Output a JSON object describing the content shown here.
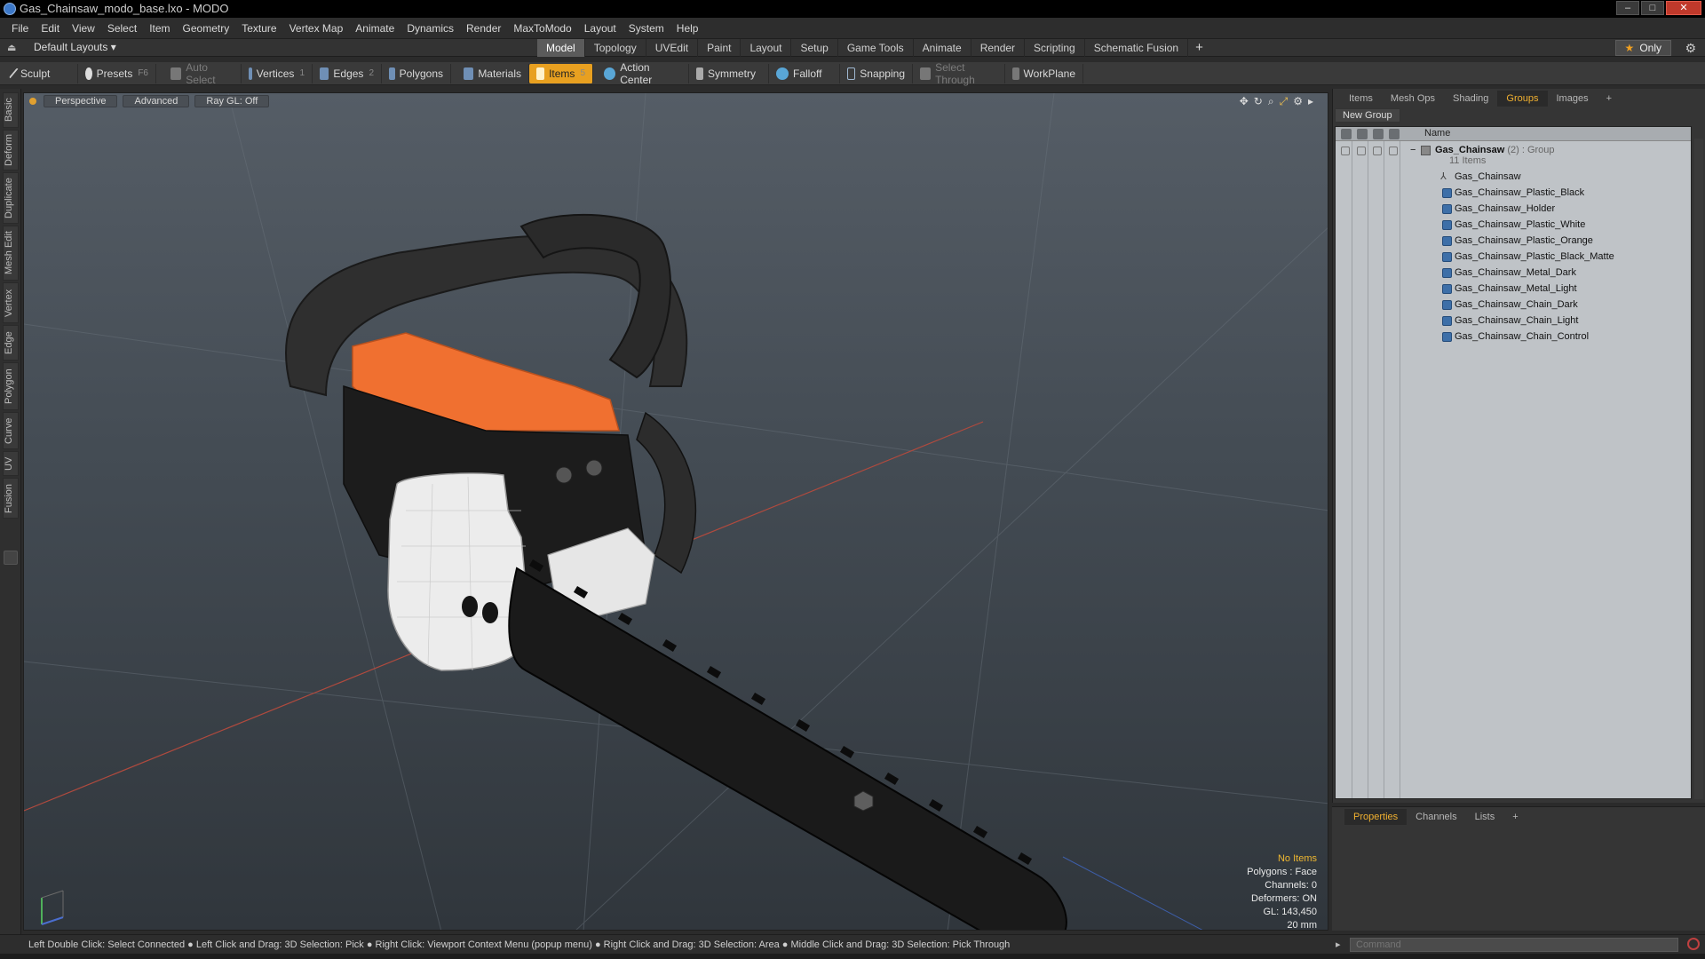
{
  "window": {
    "title": "Gas_Chainsaw_modo_base.lxo - MODO"
  },
  "menu": [
    "File",
    "Edit",
    "View",
    "Select",
    "Item",
    "Geometry",
    "Texture",
    "Vertex Map",
    "Animate",
    "Dynamics",
    "Render",
    "MaxToModo",
    "Layout",
    "System",
    "Help"
  ],
  "layoutbar": {
    "layouts_label": "Default Layouts ▾",
    "tabs": [
      "Model",
      "Topology",
      "UVEdit",
      "Paint",
      "Layout",
      "Setup",
      "Game Tools",
      "Animate",
      "Render",
      "Scripting",
      "Schematic Fusion"
    ],
    "active_tab": "Model",
    "add": "+",
    "only_label": "Only"
  },
  "toolbar": {
    "sculpt": "Sculpt",
    "presets": "Presets",
    "presets_key": "F6",
    "auto_select": "Auto Select",
    "vertices": "Vertices",
    "vertices_key": "1",
    "edges": "Edges",
    "edges_key": "2",
    "polygons": "Polygons",
    "materials": "Materials",
    "items": "Items",
    "items_key": "5",
    "action_center": "Action Center",
    "symmetry": "Symmetry",
    "falloff": "Falloff",
    "snapping": "Snapping",
    "select_through": "Select Through",
    "workplane": "WorkPlane"
  },
  "left_tabs": [
    "Basic",
    "Deform",
    "Duplicate",
    "Mesh Edit",
    "Vertex",
    "Edge",
    "Polygon",
    "Curve",
    "UV",
    "Fusion"
  ],
  "viewport": {
    "view_mode": "Perspective",
    "shading": "Advanced",
    "ray_gl": "Ray GL: Off",
    "info": {
      "selection": "No Items",
      "polygons": "Polygons : Face",
      "channels": "Channels: 0",
      "deformers": "Deformers: ON",
      "gl": "GL: 143,450",
      "scale": "20 mm"
    }
  },
  "right_panel": {
    "tabs": [
      "Items",
      "Mesh Ops",
      "Shading",
      "Groups",
      "Images"
    ],
    "active_tab": "Groups",
    "add": "+",
    "new_group": "New Group",
    "column_name": "Name",
    "group": {
      "name": "Gas_Chainsaw",
      "count": "(2)",
      "type": ": Group",
      "items_count": "11 Items"
    },
    "items": [
      {
        "name": "Gas_Chainsaw",
        "kind": "locator"
      },
      {
        "name": "Gas_Chainsaw_Plastic_Black",
        "kind": "mesh"
      },
      {
        "name": "Gas_Chainsaw_Holder",
        "kind": "mesh"
      },
      {
        "name": "Gas_Chainsaw_Plastic_White",
        "kind": "mesh"
      },
      {
        "name": "Gas_Chainsaw_Plastic_Orange",
        "kind": "mesh"
      },
      {
        "name": "Gas_Chainsaw_Plastic_Black_Matte",
        "kind": "mesh"
      },
      {
        "name": "Gas_Chainsaw_Metal_Dark",
        "kind": "mesh"
      },
      {
        "name": "Gas_Chainsaw_Metal_Light",
        "kind": "mesh"
      },
      {
        "name": "Gas_Chainsaw_Chain_Dark",
        "kind": "mesh"
      },
      {
        "name": "Gas_Chainsaw_Chain_Light",
        "kind": "mesh"
      },
      {
        "name": "Gas_Chainsaw_Chain_Control",
        "kind": "mesh"
      }
    ]
  },
  "properties_panel": {
    "tabs": [
      "Properties",
      "Channels",
      "Lists"
    ],
    "active_tab": "Properties",
    "add": "+"
  },
  "status_bar": {
    "text": "Left Double Click: Select Connected ● Left Click and Drag: 3D Selection: Pick ● Right Click: Viewport Context Menu (popup menu) ● Right Click and Drag: 3D Selection: Area ● Middle Click and Drag: 3D Selection: Pick Through"
  },
  "command": {
    "placeholder": "Command"
  },
  "colors": {
    "accent_orange": "#e8a020",
    "active_tab_text": "#f0b030",
    "chainsaw_orange": "#f07030"
  }
}
